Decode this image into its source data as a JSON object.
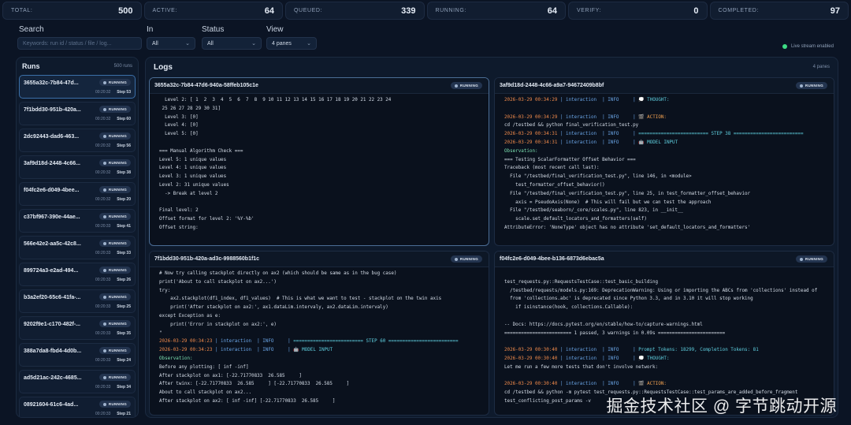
{
  "stats": [
    {
      "key": "TOTAL:",
      "value": "500"
    },
    {
      "key": "ACTIVE:",
      "value": "64"
    },
    {
      "key": "QUEUED:",
      "value": "339"
    },
    {
      "key": "RUNNING:",
      "value": "64"
    },
    {
      "key": "VERIFY:",
      "value": "0"
    },
    {
      "key": "COMPLETED:",
      "value": "97"
    }
  ],
  "filters": {
    "search_label": "Search",
    "search_placeholder": "Keywords: run id / status / file / log...",
    "in_label": "In",
    "in_value": "All",
    "status_label": "Status",
    "status_value": "All",
    "view_label": "View",
    "view_value": "4 panes",
    "live_text": "Live stream enabled"
  },
  "runs": {
    "title": "Runs",
    "count": "500 runs",
    "items": [
      {
        "id": "3655a32c-7b84-47d...",
        "status": "RUNNING",
        "time": "00:20:32",
        "step": "Step 53"
      },
      {
        "id": "7f1bdd30-951b-420a...",
        "status": "RUNNING",
        "time": "00:20:32",
        "step": "Step 60"
      },
      {
        "id": "2dc92443-dad6-463...",
        "status": "RUNNING",
        "time": "00:20:32",
        "step": "Step 56"
      },
      {
        "id": "3af9d18d-2448-4c66...",
        "status": "RUNNING",
        "time": "00:20:32",
        "step": "Step 38"
      },
      {
        "id": "f04fc2e6-d049-4bee...",
        "status": "RUNNING",
        "time": "00:20:32",
        "step": "Step 20"
      },
      {
        "id": "c37bf967-390e-44ae...",
        "status": "RUNNING",
        "time": "00:20:33",
        "step": "Step 41"
      },
      {
        "id": "566e42e2-aa5c-42c8...",
        "status": "RUNNING",
        "time": "00:20:33",
        "step": "Step 33"
      },
      {
        "id": "899724a3-e2ad-494...",
        "status": "RUNNING",
        "time": "00:20:33",
        "step": "Step 26"
      },
      {
        "id": "b3a2ef20-65c6-41fa-...",
        "status": "RUNNING",
        "time": "00:20:33",
        "step": "Step 25"
      },
      {
        "id": "9202f9e1-c170-482f-...",
        "status": "RUNNING",
        "time": "00:20:33",
        "step": "Step 35"
      },
      {
        "id": "388a7da8-fbd4-4d0b...",
        "status": "RUNNING",
        "time": "00:20:33",
        "step": "Step 24"
      },
      {
        "id": "ad5d21ac-242c-4685...",
        "status": "RUNNING",
        "time": "00:20:33",
        "step": "Step 34"
      },
      {
        "id": "08921604-61c6-4ad...",
        "status": "RUNNING",
        "time": "00:20:33",
        "step": "Step 21"
      }
    ]
  },
  "logs": {
    "title": "Logs",
    "count": "4 panes",
    "panes": [
      {
        "name": "3655a32c-7b84-47d6-940a-58ffeb105c1e",
        "status": "RUNNING",
        "lines": [
          {
            "t": "  Level 2: [ 1  2  3  4  5  6  7  8  9 10 11 12 13 14 15 16 17 18 19 20 21 22 23 24"
          },
          {
            "t": " 25 26 27 28 29 30 31]"
          },
          {
            "t": "  Level 3: [0]"
          },
          {
            "t": "  Level 4: [0]"
          },
          {
            "t": "  Level 5: [0]"
          },
          {
            "t": ""
          },
          {
            "t": "=== Manual Algorithm Check ==="
          },
          {
            "t": "Level 5: 1 unique values"
          },
          {
            "t": "Level 4: 1 unique values"
          },
          {
            "t": "Level 3: 1 unique values"
          },
          {
            "t": "Level 2: 31 unique values"
          },
          {
            "t": "  -> Break at level 2"
          },
          {
            "t": ""
          },
          {
            "t": "Final level: 2"
          },
          {
            "t": "Offset format for level 2: '%Y-%b'"
          },
          {
            "t": "Offset string:"
          }
        ]
      },
      {
        "name": "3af9d18d-2448-4c66-a9a7-94672409b8bf",
        "status": "RUNNING",
        "lines": [
          {
            "ts": "2026-03-29 00:34:29",
            "lvl": "| interaction  | INFO     |",
            "m": " 💭 THOUGHT:",
            "mc": "cy"
          },
          {
            "t": ""
          },
          {
            "ts": "2026-03-29 00:34:29",
            "lvl": "| interaction  | INFO     |",
            "m": " 🎬 ACTION:",
            "mc": "act"
          },
          {
            "t": "cd /testbed && python final_verification_test.py"
          },
          {
            "ts": "2026-03-29 00:34:31",
            "lvl": "| interaction  | INFO     |",
            "m": " ========================= STEP 38 =========================",
            "mc": "cy"
          },
          {
            "ts": "2026-03-29 00:34:31",
            "lvl": "| interaction  | INFO     |",
            "m": " 🤖 MODEL INPUT",
            "mc": "cy"
          },
          {
            "t": "Observation:",
            "c": "obs"
          },
          {
            "t": "=== Testing ScalarFormatter Offset Behavior ==="
          },
          {
            "t": "Traceback (most recent call last):"
          },
          {
            "t": "  File \"/testbed/final_verification_test.py\", line 146, in <module>"
          },
          {
            "t": "    test_formatter_offset_behavior()"
          },
          {
            "t": "  File \"/testbed/final_verification_test.py\", line 25, in test_formatter_offset_behavior"
          },
          {
            "t": "    axis = PseudoAxis(None)  # This will fail but we can test the approach"
          },
          {
            "t": "  File \"/testbed/seaborn/_core/scales.py\", line 823, in __init__"
          },
          {
            "t": "    scale.set_default_locators_and_formatters(self)"
          },
          {
            "t": "AttributeError: 'NoneType' object has no attribute 'set_default_locators_and_formatters'"
          }
        ]
      },
      {
        "name": "7f1bdd30-951b-420a-ad3c-9988560b1f1c",
        "status": "RUNNING",
        "lines": [
          {
            "t": "# Now try calling stackplot directly on ax2 (which should be same as in the bug case)"
          },
          {
            "t": "print('About to call stackplot on ax2...')"
          },
          {
            "t": "try:"
          },
          {
            "t": "    ax2.stackplot(df1_index, df1_values)  # This is what we want to test - stackplot on the twin axis"
          },
          {
            "t": "    print('After stackplot on ax2:', ax1.dataLim.intervaly, ax2.dataLim.intervaly)"
          },
          {
            "t": "except Exception as e:"
          },
          {
            "t": "    print('Error in stackplot on ax2:', e)"
          },
          {
            "t": "\""
          },
          {
            "ts": "2026-03-29 00:34:23",
            "lvl": "| interaction  | INFO     |",
            "m": " ========================= STEP 60 =========================",
            "mc": "cy"
          },
          {
            "ts": "2026-03-29 00:34:23",
            "lvl": "| interaction  | INFO     |",
            "m": " 🤖 MODEL INPUT",
            "mc": "cy"
          },
          {
            "t": "Observation:",
            "c": "obs"
          },
          {
            "t": "Before any plotting: [ inf -inf]"
          },
          {
            "t": "After stackplot on ax1: [-22.71770833  26.585     ]"
          },
          {
            "t": "After twinx: [-22.71770833  26.585     ] [-22.71770833  26.585     ]"
          },
          {
            "t": "About to call stackplot on ax2..."
          },
          {
            "t": "After stackplot on ax2: [ inf -inf] [-22.71770833  26.585     ]"
          }
        ]
      },
      {
        "name": "f04fc2e6-d049-4bee-b136-6873d6ebac5a",
        "status": "RUNNING",
        "lines": [
          {
            "t": ""
          },
          {
            "t": "test_requests.py::RequestsTestCase::test_basic_building"
          },
          {
            "t": "  /testbed/requests/models.py:169: DeprecationWarning: Using or importing the ABCs from 'collections' instead of"
          },
          {
            "t": "  from 'collections.abc' is deprecated since Python 3.3, and in 3.10 it will stop working"
          },
          {
            "t": "    if isinstance(hook, collections.Callable):"
          },
          {
            "t": ""
          },
          {
            "t": "-- Docs: https://docs.pytest.org/en/stable/how-to/capture-warnings.html"
          },
          {
            "t": "======================== 1 passed, 3 warnings in 0.09s ========================"
          },
          {
            "t": ""
          },
          {
            "ts": "2026-03-29 00:30:40",
            "lvl": "| interaction  | INFO     |",
            "m": " Prompt Tokens: 18299, Completion Tokens: 81",
            "mc": "cy"
          },
          {
            "ts": "2026-03-29 00:30:40",
            "lvl": "| interaction  | INFO     |",
            "m": " 💭 THOUGHT:",
            "mc": "cy"
          },
          {
            "t": "Let me run a few more tests that don't involve network:"
          },
          {
            "t": ""
          },
          {
            "ts": "2026-03-29 00:30:40",
            "lvl": "| interaction  | INFO     |",
            "m": " 🎬 ACTION:",
            "mc": "act"
          },
          {
            "t": "cd /testbed && python -m pytest test_requests.py::RequestsTestCase::test_params_are_added_before_fragment"
          },
          {
            "t": "test_conflicting_post_params -v"
          }
        ]
      }
    ]
  },
  "watermark": "掘金技术社区 @ 字节跳动开源"
}
